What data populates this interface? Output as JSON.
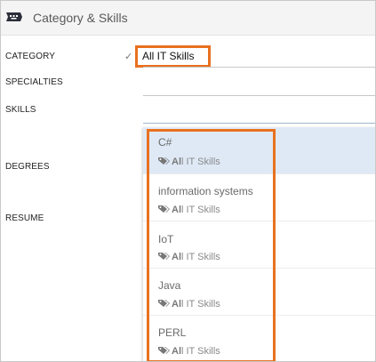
{
  "window": {
    "title": "Category & Skills"
  },
  "icons": {
    "title_icon": "keyboard-icon",
    "tag_icon": "tags-icon",
    "check_icon": "check-icon"
  },
  "form": {
    "category_label": "CATEGORY",
    "category_value": "All IT Skills",
    "specialties_label": "SPECIALTIES",
    "skills_label": "SKILLS",
    "degrees_label": "DEGREES",
    "resume_label": "RESUME"
  },
  "dropdown": {
    "options": [
      {
        "name": "C#",
        "tag_bold": "Al",
        "tag_rest": "l IT Skills",
        "selected": true
      },
      {
        "name": "information systems",
        "tag_bold": "Al",
        "tag_rest": "l IT Skills",
        "selected": false
      },
      {
        "name": "IoT",
        "tag_bold": "Al",
        "tag_rest": "l IT Skills",
        "selected": false
      },
      {
        "name": "Java",
        "tag_bold": "Al",
        "tag_rest": "l IT Skills",
        "selected": false
      },
      {
        "name": "PERL",
        "tag_bold": "Al",
        "tag_rest": "l IT Skills",
        "selected": false
      }
    ]
  },
  "colors": {
    "highlight": "#e8711f",
    "selected_row": "#dfe9f6"
  }
}
